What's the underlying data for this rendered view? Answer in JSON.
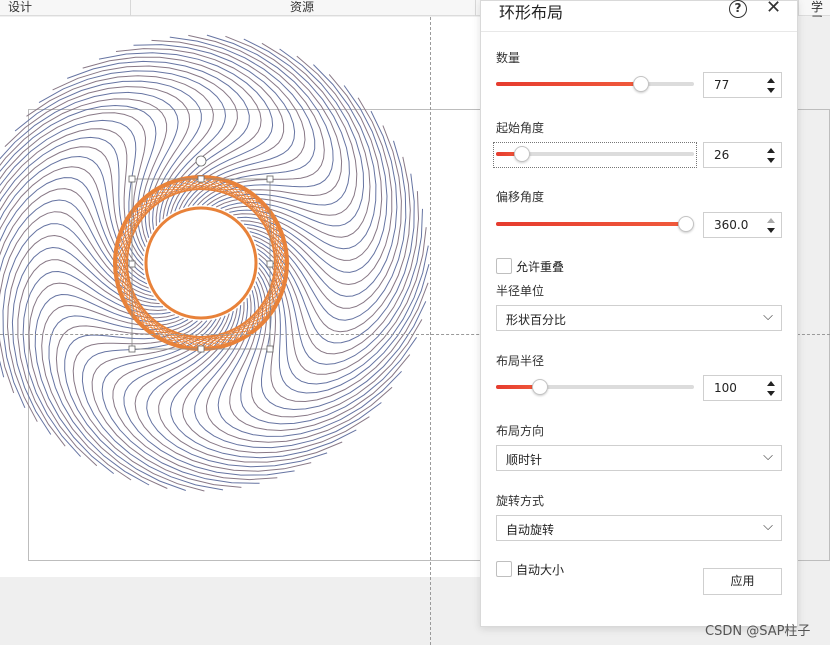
{
  "top_tabs": {
    "design": "设计",
    "resources": "资源",
    "learn": "学习"
  },
  "panel": {
    "title": "环形布局",
    "help_icon": "question-circle-icon",
    "close_icon": "close-icon",
    "count": {
      "label": "数量",
      "value": "77",
      "fraction": 0.75
    },
    "start_angle": {
      "label": "起始角度",
      "value": "26",
      "fraction": 0.1
    },
    "offset_angle": {
      "label": "偏移角度",
      "value": "360.0",
      "fraction": 1.0
    },
    "allow_overlap": {
      "label": "允许重叠",
      "checked": false
    },
    "radius_unit": {
      "label": "半径单位",
      "value": "形状百分比"
    },
    "layout_radius": {
      "label": "布局半径",
      "value": "100",
      "fraction": 0.2
    },
    "layout_direction": {
      "label": "布局方向",
      "value": "顺时针"
    },
    "rotation_mode": {
      "label": "旋转方式",
      "value": "自动旋转"
    },
    "auto_size": {
      "label": "自动大小",
      "checked": false
    },
    "apply_button": "应用"
  },
  "watermark": "CSDN @SAP柱子",
  "colors": {
    "slider_fill": "#e63b2e",
    "spiral_outer": "#3a6fc4",
    "spiral_inner": "#e8823a"
  }
}
